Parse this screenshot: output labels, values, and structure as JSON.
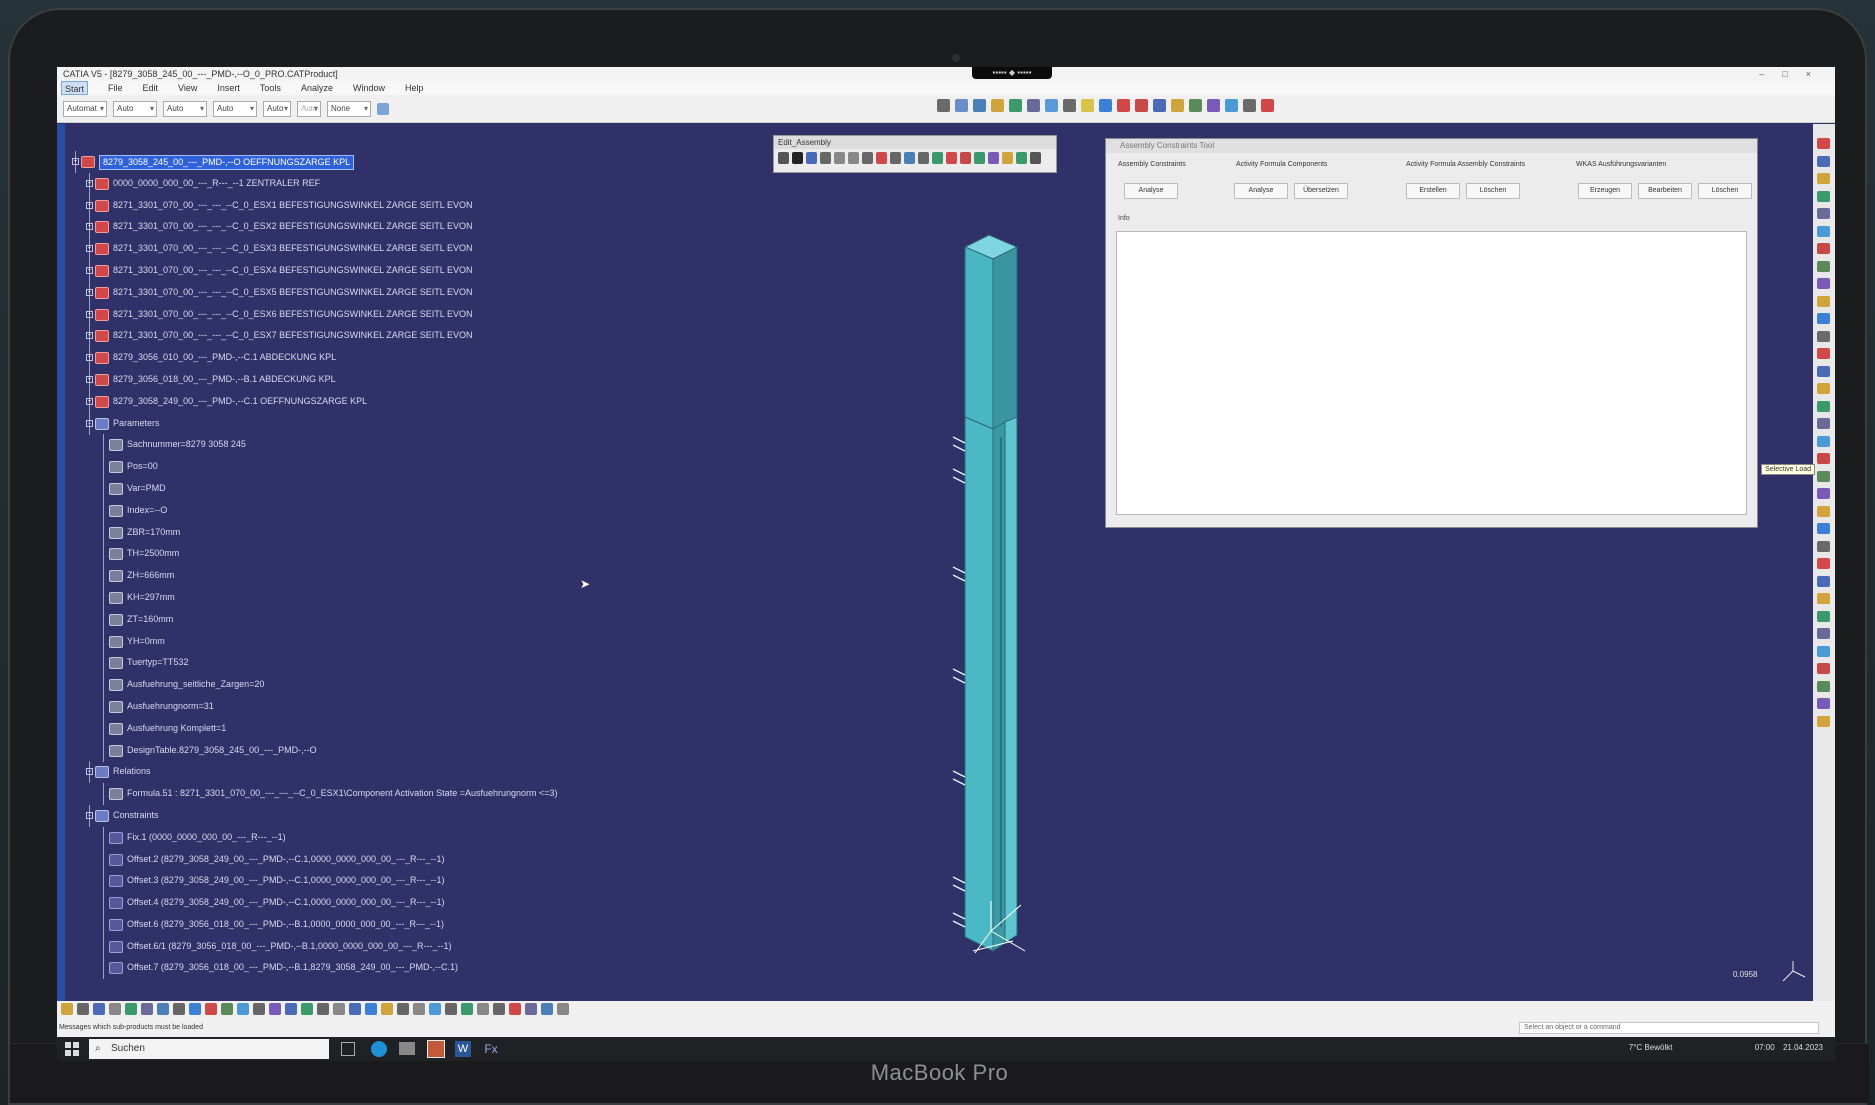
{
  "device": {
    "brand_label": "MacBook Pro"
  },
  "window": {
    "title": "CATIA V5 - [8279_3058_245_00_---_PMD-,--O_0_PRO.CATProduct]",
    "menus": [
      "Start",
      "File",
      "Edit",
      "View",
      "Insert",
      "Tools",
      "Analyze",
      "Window",
      "Help"
    ],
    "toolbar_selects": [
      "Automat",
      "Auto",
      "Auto",
      "Auto",
      "Auto",
      "Auto"
    ],
    "linetype_select": "None"
  },
  "tree": {
    "rows": [
      {
        "text": "8279_3058_245_00_---_PMD-,--O OEFFNUNGSZARGE KPL",
        "depth": 0,
        "kind": "prod",
        "highlighted": true
      },
      {
        "text": "0000_0000_000_00_---_R---_--1 ZENTRALER REF",
        "depth": 1,
        "kind": "prod"
      },
      {
        "text": "8271_3301_070_00_---_---_--C_0_ESX1 BEFESTIGUNGSWINKEL ZARGE SEITL EVON",
        "depth": 1,
        "kind": "prod"
      },
      {
        "text": "8271_3301_070_00_---_---_--C_0_ESX2 BEFESTIGUNGSWINKEL ZARGE SEITL EVON",
        "depth": 1,
        "kind": "prod"
      },
      {
        "text": "8271_3301_070_00_---_---_--C_0_ESX3 BEFESTIGUNGSWINKEL ZARGE SEITL EVON",
        "depth": 1,
        "kind": "prod"
      },
      {
        "text": "8271_3301_070_00_---_---_--C_0_ESX4 BEFESTIGUNGSWINKEL ZARGE SEITL EVON",
        "depth": 1,
        "kind": "prod"
      },
      {
        "text": "8271_3301_070_00_---_---_--C_0_ESX5 BEFESTIGUNGSWINKEL ZARGE SEITL EVON",
        "depth": 1,
        "kind": "prod"
      },
      {
        "text": "8271_3301_070_00_---_---_--C_0_ESX6 BEFESTIGUNGSWINKEL ZARGE SEITL EVON",
        "depth": 1,
        "kind": "prod"
      },
      {
        "text": "8271_3301_070_00_---_---_--C_0_ESX7 BEFESTIGUNGSWINKEL ZARGE SEITL EVON",
        "depth": 1,
        "kind": "prod"
      },
      {
        "text": "8279_3056_010_00_---_PMD-,--C.1 ABDECKUNG KPL",
        "depth": 1,
        "kind": "prod"
      },
      {
        "text": "8279_3056_018_00_---_PMD-,--B.1 ABDECKUNG KPL",
        "depth": 1,
        "kind": "prod"
      },
      {
        "text": "8279_3058_249_00_---_PMD-,--C.1 OEFFNUNGSZARGE KPL",
        "depth": 1,
        "kind": "prod"
      },
      {
        "text": "Parameters",
        "depth": 1,
        "kind": "folder"
      },
      {
        "text": "Sachnummer=8279 3058 245",
        "depth": 2,
        "kind": "par"
      },
      {
        "text": "Pos=00",
        "depth": 2,
        "kind": "par"
      },
      {
        "text": "Var=PMD",
        "depth": 2,
        "kind": "par"
      },
      {
        "text": "Index=--O",
        "depth": 2,
        "kind": "par"
      },
      {
        "text": "ZBR=170mm",
        "depth": 2,
        "kind": "par"
      },
      {
        "text": "TH=2500mm",
        "depth": 2,
        "kind": "par"
      },
      {
        "text": "ZH=666mm",
        "depth": 2,
        "kind": "par"
      },
      {
        "text": "KH=297mm",
        "depth": 2,
        "kind": "par"
      },
      {
        "text": "ZT=160mm",
        "depth": 2,
        "kind": "par"
      },
      {
        "text": "YH=0mm",
        "depth": 2,
        "kind": "par"
      },
      {
        "text": "Tuertyp=TT532",
        "depth": 2,
        "kind": "par"
      },
      {
        "text": "Ausfuehrung_seitliche_Zargen=20",
        "depth": 2,
        "kind": "par"
      },
      {
        "text": "Ausfuehrungnorm=31",
        "depth": 2,
        "kind": "par"
      },
      {
        "text": "Ausfuehrung Komplett=1",
        "depth": 2,
        "kind": "par"
      },
      {
        "text": "DesignTable.8279_3058_245_00_---_PMD-,--O",
        "depth": 2,
        "kind": "par"
      },
      {
        "text": "Relations",
        "depth": 1,
        "kind": "folder"
      },
      {
        "text": "Formula.51 : 8271_3301_070_00_---_---_--C_0_ESX1\\Component Activation State =Ausfuehrungnorm <=3)",
        "depth": 2,
        "kind": "par"
      },
      {
        "text": "Constraints",
        "depth": 1,
        "kind": "folder"
      },
      {
        "text": "Fix.1 (0000_0000_000_00_---_R---_--1)",
        "depth": 2,
        "kind": "con"
      },
      {
        "text": "Offset.2 (8279_3058_249_00_---_PMD-,--C.1,0000_0000_000_00_---_R---_--1)",
        "depth": 2,
        "kind": "con"
      },
      {
        "text": "Offset.3 (8279_3058_249_00_---_PMD-,--C.1,0000_0000_000_00_---_R---_--1)",
        "depth": 2,
        "kind": "con"
      },
      {
        "text": "Offset.4 (8279_3058_249_00_---_PMD-,--C.1,0000_0000_000_00_---_R---_--1)",
        "depth": 2,
        "kind": "con"
      },
      {
        "text": "Offset.6 (8279_3056_018_00_---_PMD-,--B.1,0000_0000_000_00_---_R---_--1)",
        "depth": 2,
        "kind": "con"
      },
      {
        "text": "Offset.6/1 (8279_3056_018_00_---_PMD-,--B.1,0000_0000_000_00_---_R---_--1)",
        "depth": 2,
        "kind": "con"
      },
      {
        "text": "Offset.7 (8279_3056_018_00_---_PMD-,--B.1,8279_3058_249_00_---_PMD-,--C.1)",
        "depth": 2,
        "kind": "con"
      }
    ]
  },
  "assembly_toolbar": {
    "title": "Edit_Assembly"
  },
  "panel": {
    "title": "Assembly Constraints Tool",
    "groups": [
      {
        "label": "Assembly Constraints",
        "buttons": [
          "Analyse"
        ]
      },
      {
        "label": "Activity Formula Components",
        "buttons": [
          "Analyse",
          "Übersetzen"
        ]
      },
      {
        "label": "Activity Formula Assembly Constraints",
        "buttons": [
          "Erstellen",
          "Löschen"
        ]
      },
      {
        "label": "WKAS Ausführungsvarianten",
        "buttons": [
          "Erzeugen",
          "Bearbeiten",
          "Löschen"
        ]
      }
    ],
    "info_label": "Info"
  },
  "viewport": {
    "scale_label": "0.0958"
  },
  "status": {
    "message": "Messages which sub-products must be loaded",
    "command_placeholder": "Select an object or a command"
  },
  "right_toolbar": {
    "tooltip": "Selective Load"
  },
  "taskbar": {
    "search_placeholder": "Suchen",
    "weather": "7°C Bewölkt",
    "time": "07:00",
    "date": "21.04.2023"
  },
  "colors": {
    "viewport_bg": "#2f3168",
    "part": "#48b6c3",
    "highlight": "#2f62d8"
  }
}
